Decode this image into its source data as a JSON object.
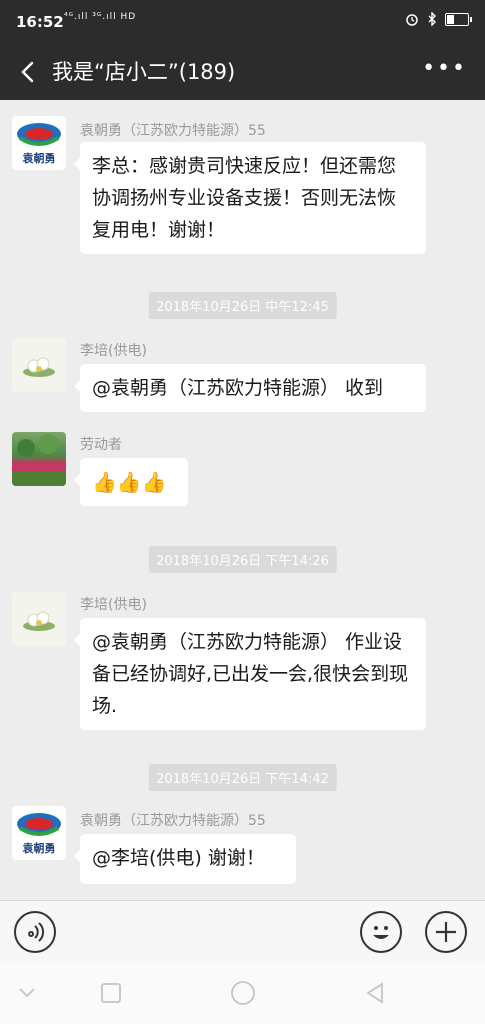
{
  "status": {
    "time": "16:52",
    "signal": "⁴ᴳ.ıll ³ᴳ.ıll HD",
    "battery_level": 0.35
  },
  "header": {
    "title": "我是“店小二”(189)"
  },
  "messages": [
    {
      "sender": "袁朝勇（江苏欧力特能源）55",
      "text": "李总：感谢贵司快速反应！但还需您协调扬州专业设备支援！否则无法恢复用电！谢谢！",
      "avatar": "company-logo"
    },
    {
      "timestamp": "2018年10月26日 中午12:45"
    },
    {
      "sender": "李培(供电)",
      "text": "@袁朝勇（江苏欧力特能源） 收到",
      "avatar": "flower"
    },
    {
      "sender": "劳动者",
      "text": "👍👍👍",
      "avatar": "garden"
    },
    {
      "timestamp": "2018年10月26日 下午14:26"
    },
    {
      "sender": "李培(供电)",
      "text": "@袁朝勇（江苏欧力特能源） 作业设备已经协调好,已出发一会,很快会到现场.",
      "avatar": "flower"
    },
    {
      "timestamp": "2018年10月26日 下午14:42"
    },
    {
      "sender": "袁朝勇（江苏欧力特能源）55",
      "text": "@李培(供电) 谢谢！",
      "avatar": "company-logo"
    }
  ],
  "logo_text": "袁朝勇",
  "icons": [
    "back-icon",
    "more-icon",
    "voice-icon",
    "emoji-icon",
    "plus-icon",
    "nav-back-icon",
    "nav-home-icon",
    "nav-recent-icon"
  ]
}
